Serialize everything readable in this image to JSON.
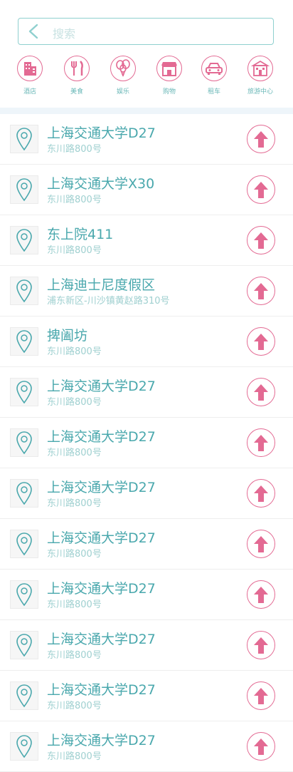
{
  "search": {
    "placeholder": "搜索",
    "back_icon": "chevron-left-icon"
  },
  "categories": [
    {
      "label": "酒店",
      "icon": "hotel-icon"
    },
    {
      "label": "美食",
      "icon": "food-icon"
    },
    {
      "label": "娱乐",
      "icon": "balloons-icon"
    },
    {
      "label": "购物",
      "icon": "shop-icon"
    },
    {
      "label": "租车",
      "icon": "car-icon"
    },
    {
      "label": "旅游中心",
      "icon": "travel-center-icon"
    }
  ],
  "places": [
    {
      "name": "上海交通大学D27",
      "address": "东川路800号"
    },
    {
      "name": "上海交通大学X30",
      "address": "东川路800号"
    },
    {
      "name": "东上院411",
      "address": "东川路800号"
    },
    {
      "name": "上海迪士尼度假区",
      "address": "浦东新区-川沙镇黄赵路310号"
    },
    {
      "name": "捭阖坊",
      "address": "东川路800号"
    },
    {
      "name": "上海交通大学D27",
      "address": "东川路800号"
    },
    {
      "name": "上海交通大学D27",
      "address": "东川路800号"
    },
    {
      "name": "上海交通大学D27",
      "address": "东川路800号"
    },
    {
      "name": "上海交通大学D27",
      "address": "东川路800号"
    },
    {
      "name": "上海交通大学D27",
      "address": "东川路800号"
    },
    {
      "name": "上海交通大学D27",
      "address": "东川路800号"
    },
    {
      "name": "上海交通大学D27",
      "address": "东川路800号"
    },
    {
      "name": "上海交通大学D27",
      "address": "东川路800号"
    }
  ],
  "colors": {
    "accent": "#e36a93",
    "teal": "#4aa8ad",
    "light_teal": "#9fd0d0"
  }
}
